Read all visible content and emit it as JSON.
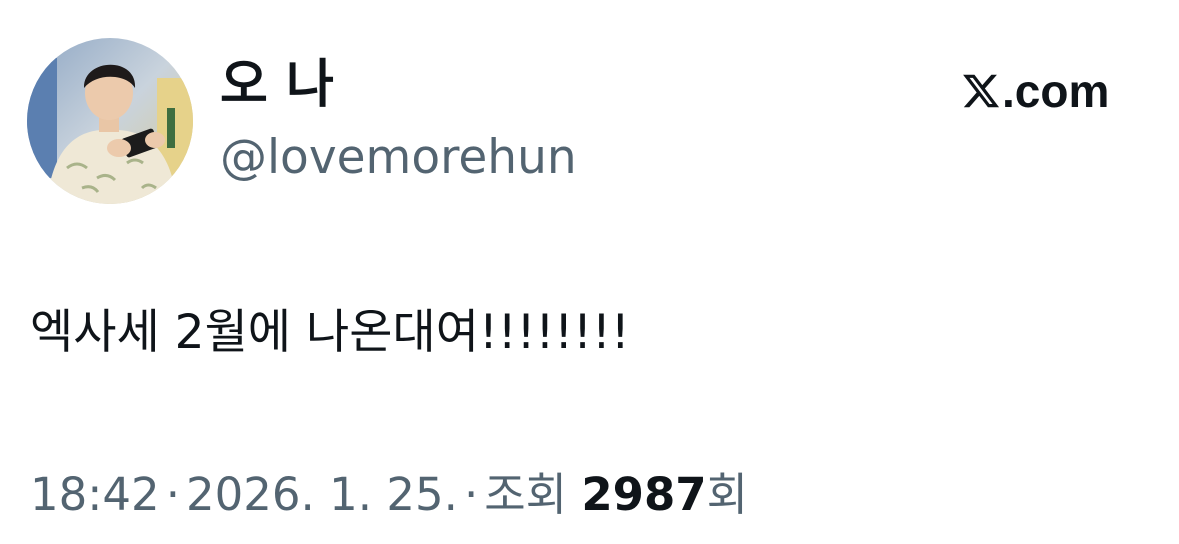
{
  "tweet": {
    "author": {
      "display_name": "오 나",
      "handle": "@lovemorehun",
      "avatar_icon": "profile-photo"
    },
    "brand": {
      "icon": "x-logo-icon",
      "domain": ".com"
    },
    "text": "엑사세 2월에 나온대여!!!!!!!!",
    "meta": {
      "time": "18:42",
      "separator": "·",
      "date": "2026. 1. 25.",
      "views_label": "조회",
      "views_count": "2987",
      "views_suffix": "회"
    }
  },
  "colors": {
    "text_primary": "#0f1419",
    "text_secondary": "#536471",
    "background": "#ffffff"
  }
}
